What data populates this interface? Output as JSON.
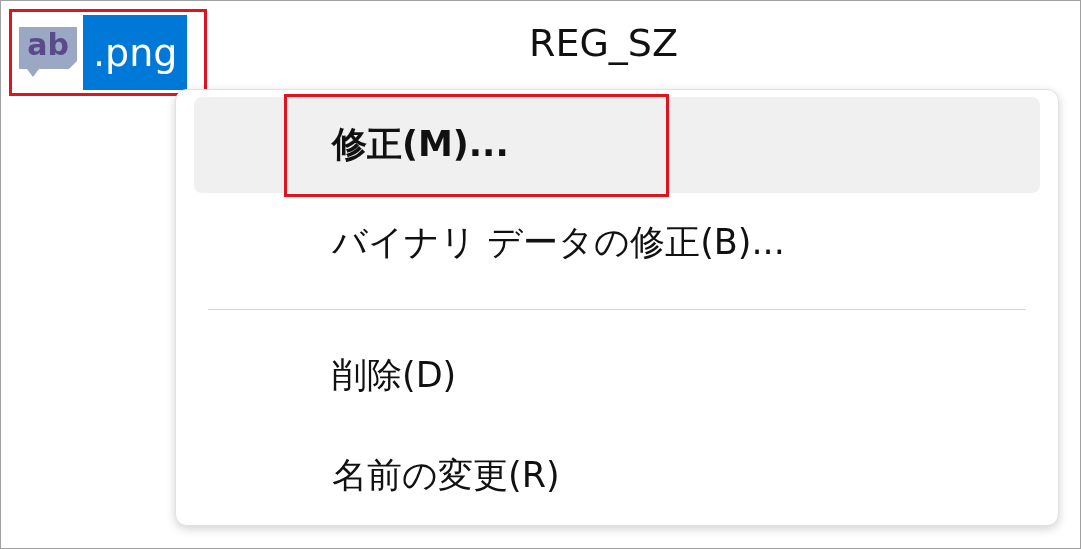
{
  "value": {
    "icon_text": "ab",
    "name": ".png",
    "selected": true,
    "highlighted": true,
    "type": "REG_SZ"
  },
  "context_menu": [
    {
      "kind": "item",
      "label": "修正(M)...",
      "selected": true,
      "bold": true,
      "highlighted": true
    },
    {
      "kind": "item",
      "label": "バイナリ データの修正(B)...",
      "selected": false,
      "bold": false,
      "highlighted": false
    },
    {
      "kind": "separator"
    },
    {
      "kind": "item",
      "label": "削除(D)",
      "selected": false,
      "bold": false,
      "highlighted": false
    },
    {
      "kind": "item",
      "label": "名前の変更(R)",
      "selected": false,
      "bold": false,
      "highlighted": false
    }
  ]
}
